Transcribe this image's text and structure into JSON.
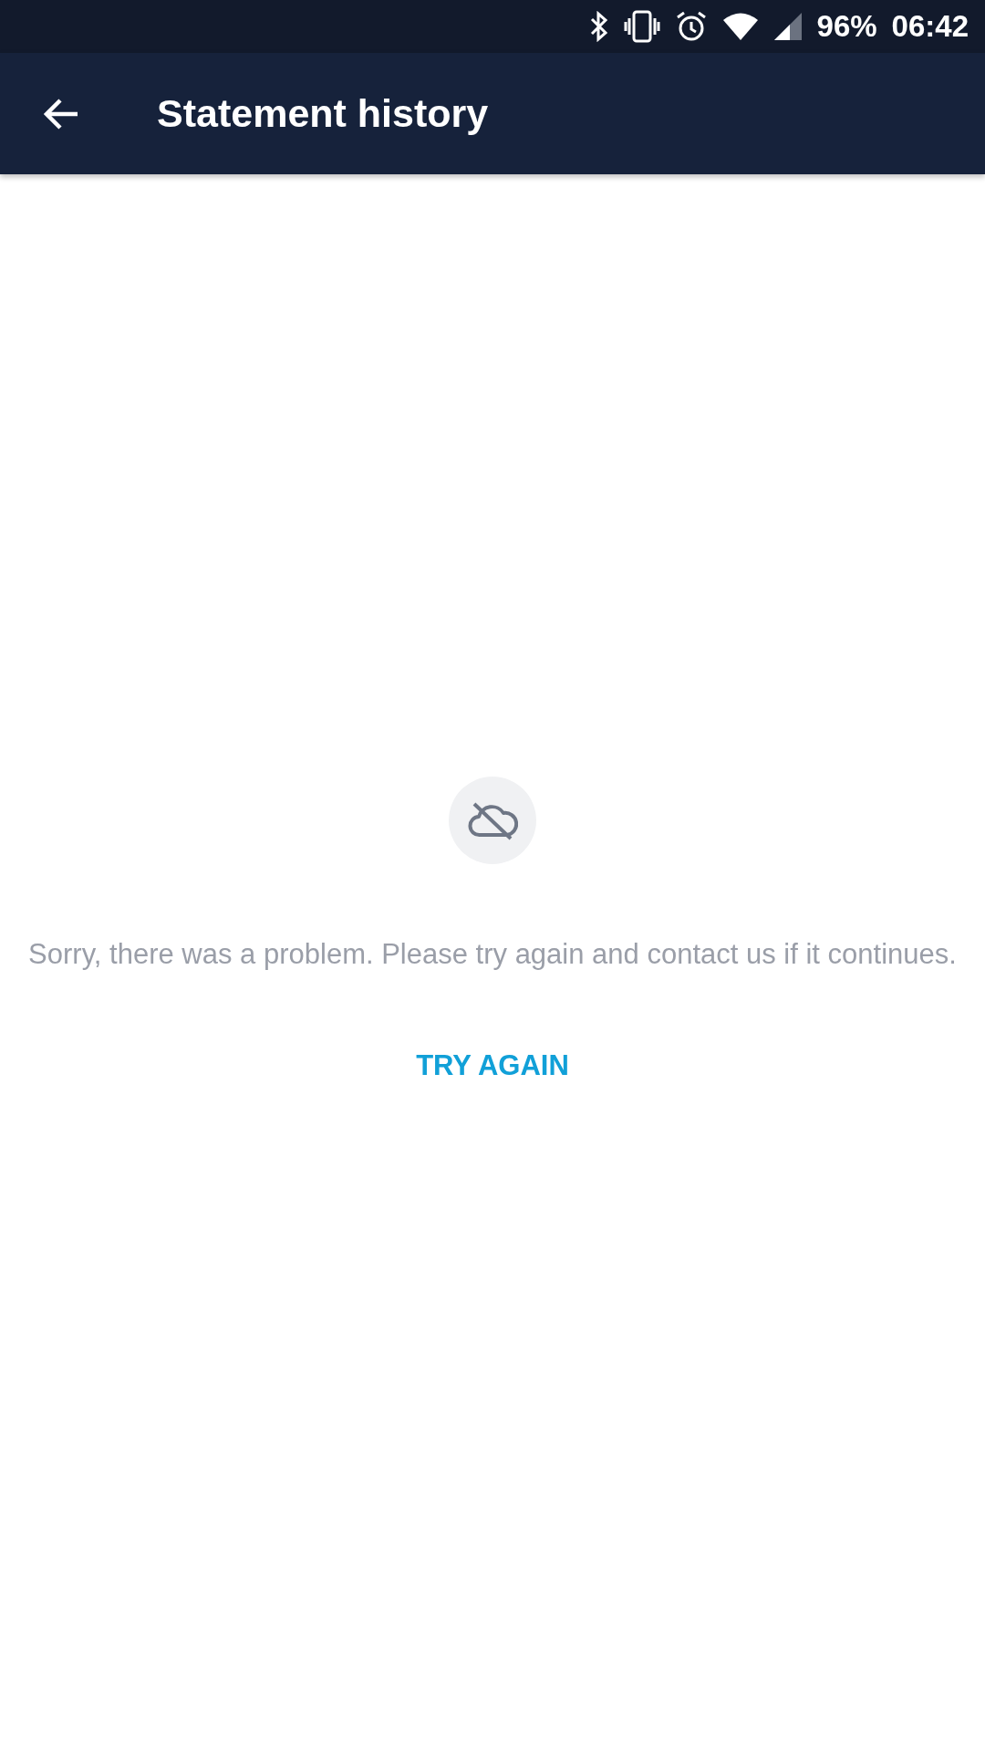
{
  "status_bar": {
    "battery": "96%",
    "time": "06:42"
  },
  "app_bar": {
    "title": "Statement history"
  },
  "error": {
    "message": "Sorry, there was a problem. Please try again and contact us if it continues.",
    "action": "TRY AGAIN"
  }
}
